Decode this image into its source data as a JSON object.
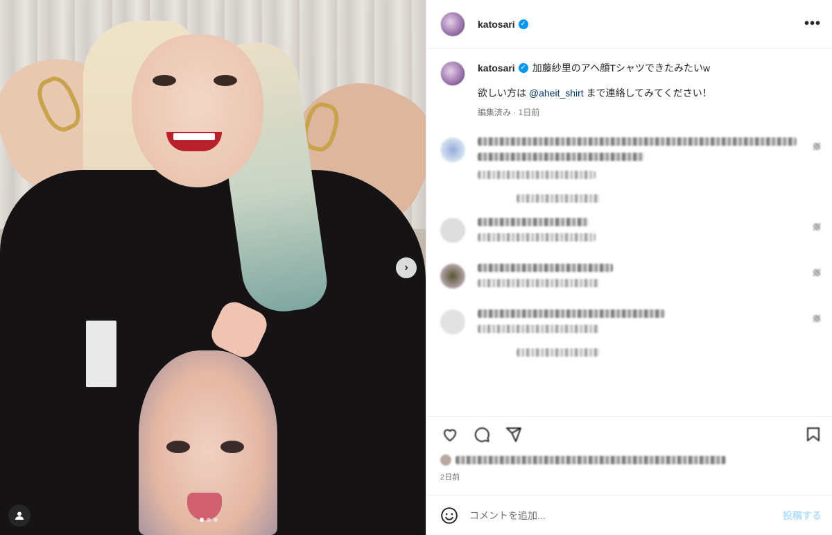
{
  "post": {
    "username": "katosari",
    "verified": true,
    "more_icon": "more-horizontal-icon"
  },
  "media": {
    "carousel_count": 3,
    "active_index": 1,
    "next_icon": "chevron-right-icon",
    "next_glyph": "›",
    "user_tag_icon": "user-tag-icon"
  },
  "caption": {
    "username": "katosari",
    "text": "加藤紗里のアヘ顔Tシャツできたみたいw",
    "line2_prefix": "欲しい方は ",
    "mention": "@aheit_shirt",
    "line2_suffix": " まで連絡してみてください！",
    "meta": "編集済み · 1日前"
  },
  "footer": {
    "post_date": "2日前",
    "comment_placeholder": "コメントを追加...",
    "post_button": "投稿する"
  },
  "colors": {
    "accent": "#0095f6",
    "mention": "#00376b",
    "post_button_disabled": "#b2dffc",
    "muted": "#737373"
  }
}
